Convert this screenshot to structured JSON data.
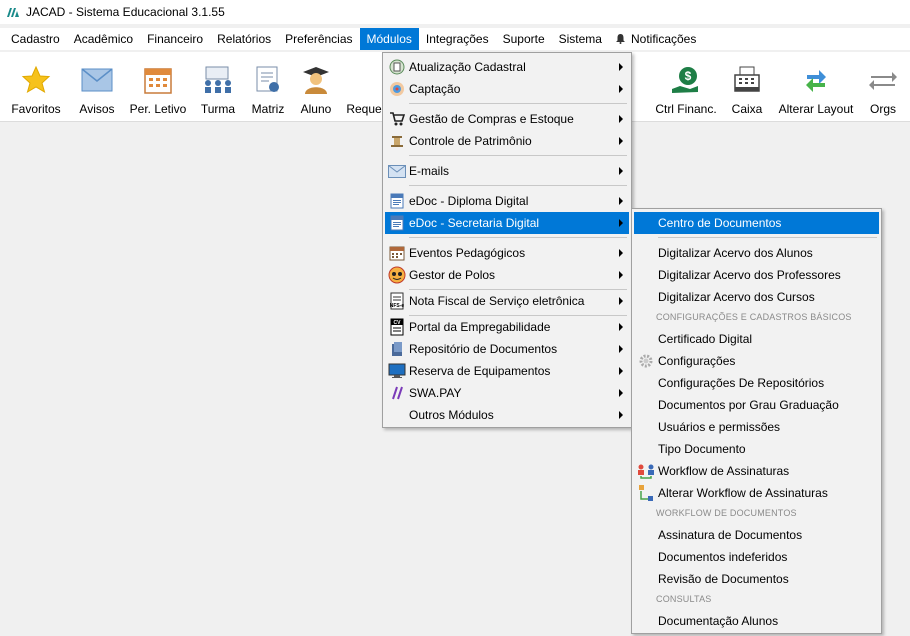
{
  "window": {
    "title": "JACAD - Sistema Educacional 3.1.55"
  },
  "menubar": {
    "items": [
      {
        "label": "Cadastro"
      },
      {
        "label": "Acadêmico"
      },
      {
        "label": "Financeiro"
      },
      {
        "label": "Relatórios"
      },
      {
        "label": "Preferências"
      },
      {
        "label": "Módulos"
      },
      {
        "label": "Integrações"
      },
      {
        "label": "Suporte"
      },
      {
        "label": "Sistema"
      },
      {
        "label": "Notificações"
      }
    ]
  },
  "toolbar": {
    "items": [
      {
        "label": "Favoritos"
      },
      {
        "label": "Avisos"
      },
      {
        "label": "Per. Letivo"
      },
      {
        "label": "Turma"
      },
      {
        "label": "Matriz"
      },
      {
        "label": "Aluno"
      },
      {
        "label": "Reque"
      },
      {
        "label": "Ctrl Financ."
      },
      {
        "label": "Caixa"
      },
      {
        "label": "Alterar Layout"
      },
      {
        "label": "Orgs"
      }
    ]
  },
  "modulos_menu": {
    "items": [
      {
        "label": "Atualização Cadastral",
        "icon": "refresh-list-icon"
      },
      {
        "label": "Captação",
        "icon": "target-icon"
      },
      {
        "label": "Gestão de Compras e Estoque",
        "icon": "cart-icon"
      },
      {
        "label": "Controle de Patrimônio",
        "icon": "column-icon"
      },
      {
        "label": "E-mails",
        "icon": "envelope-icon"
      },
      {
        "label": "eDoc - Diploma Digital",
        "icon": "doc-icon"
      },
      {
        "label": "eDoc - Secretaria Digital",
        "icon": "doc-icon"
      },
      {
        "label": "Eventos Pedagógicos",
        "icon": "calendar-icon"
      },
      {
        "label": "Gestor de Polos",
        "icon": "face-icon"
      },
      {
        "label": "Nota Fiscal de Serviço eletrônica",
        "icon": "nfse-icon"
      },
      {
        "label": "Portal da Empregabilidade",
        "icon": "cv-icon"
      },
      {
        "label": "Repositório de Documentos",
        "icon": "repository-icon"
      },
      {
        "label": "Reserva de Equipamentos",
        "icon": "monitor-icon"
      },
      {
        "label": "SWA.PAY",
        "icon": "swapay-icon"
      },
      {
        "label": "Outros Módulos",
        "icon": ""
      }
    ]
  },
  "secretaria_submenu": {
    "items": [
      {
        "label": "Centro de Documentos"
      },
      {
        "label": "Digitalizar Acervo dos Alunos"
      },
      {
        "label": "Digitalizar Acervo dos Professores"
      },
      {
        "label": "Digitalizar Acervo dos Cursos"
      },
      {
        "label": "Certificado Digital"
      },
      {
        "label": "Configurações"
      },
      {
        "label": "Configurações De Repositórios"
      },
      {
        "label": "Documentos por Grau Graduação"
      },
      {
        "label": "Usuários e permissões"
      },
      {
        "label": "Tipo Documento"
      },
      {
        "label": "Workflow de Assinaturas"
      },
      {
        "label": "Alterar Workflow de Assinaturas"
      },
      {
        "label": "Assinatura de Documentos"
      },
      {
        "label": "Documentos indeferidos"
      },
      {
        "label": "Revisão de Documentos"
      },
      {
        "label": "Documentação Alunos"
      }
    ],
    "headers": {
      "config": "CONFIGURAÇÕES E CADASTROS BÁSICOS",
      "workflow": "WORKFLOW DE DOCUMENTOS",
      "consultas": "CONSULTAS"
    }
  },
  "colors": {
    "highlight": "#0078d7",
    "menu_bg": "#f2f2f2",
    "window_bg": "#f0f0f0"
  }
}
